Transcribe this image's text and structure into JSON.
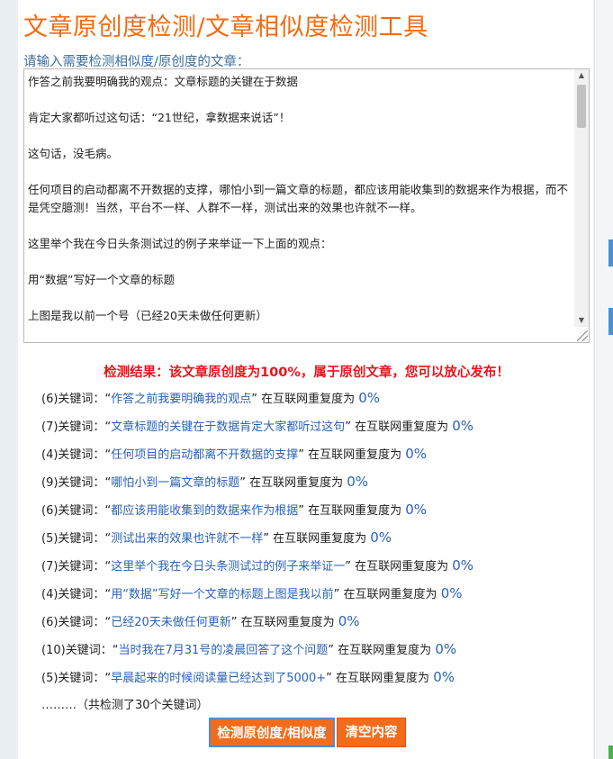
{
  "header": {
    "title": "文章原创度检测/文章相似度检测工具"
  },
  "input": {
    "label": "请输入需要检测相似度/原创度的文章：",
    "paragraphs": [
      "作答之前我要明确我的观点：文章标题的关键在于数据",
      "肯定大家都听过这句话：“21世纪，拿数据来说话”！",
      "这句话，没毛病。",
      "任何项目的启动都离不开数据的支撑，哪怕小到一篇文章的标题，都应该用能收集到的数据来作为根据，而不是凭空臆测！当然，平台不一样、人群不一样，测试出来的效果也许就不一样。",
      "这里举个我在今日头条测试过的例子来举证一下上面的观点：",
      "用“数据”写好一个文章的标题",
      "上图是我以前一个号（已经20天未做任何更新）"
    ]
  },
  "result": {
    "headline": "检测结果：该文章原创度为100%，属于原创文章，您可以放心发布！",
    "keyword_prefix": "关键词：",
    "repeat_label": "在互联网重复度为",
    "keywords": [
      {
        "count": "(6)",
        "phrase": "作答之前我要明确我的观点",
        "pct": "0%"
      },
      {
        "count": "(7)",
        "phrase": "文章标题的关键在于数据肯定大家都听过这句",
        "pct": "0%"
      },
      {
        "count": "(4)",
        "phrase": "任何项目的启动都离不开数据的支撑",
        "pct": "0%"
      },
      {
        "count": "(9)",
        "phrase": "哪怕小到一篇文章的标题",
        "pct": "0%"
      },
      {
        "count": "(6)",
        "phrase": "都应该用能收集到的数据来作为根据",
        "pct": "0%"
      },
      {
        "count": "(5)",
        "phrase": "测试出来的效果也许就不一样",
        "pct": "0%"
      },
      {
        "count": "(7)",
        "phrase": "这里举个我在今日头条测试过的例子来举证一",
        "pct": "0%"
      },
      {
        "count": "(4)",
        "phrase": "用“数据”写好一个文章的标题上图是我以前",
        "pct": "0%"
      },
      {
        "count": "(6)",
        "phrase": "已经20天未做任何更新",
        "pct": "0%"
      },
      {
        "count": "(10)",
        "phrase": "当时我在7月31号的凌晨回答了这个问题",
        "pct": "0%"
      },
      {
        "count": "(5)",
        "phrase": "早晨起来的时候阅读量已经达到了5000+",
        "pct": "0%"
      }
    ],
    "summary": "………（共检测了30个关键词）"
  },
  "actions": {
    "check_label": "检测原创度/相似度",
    "clear_label": "清空内容"
  },
  "colors": {
    "title": "#f26b12",
    "headline": "#e8141b",
    "link": "#2a62b7",
    "button": "#f26c1c"
  }
}
